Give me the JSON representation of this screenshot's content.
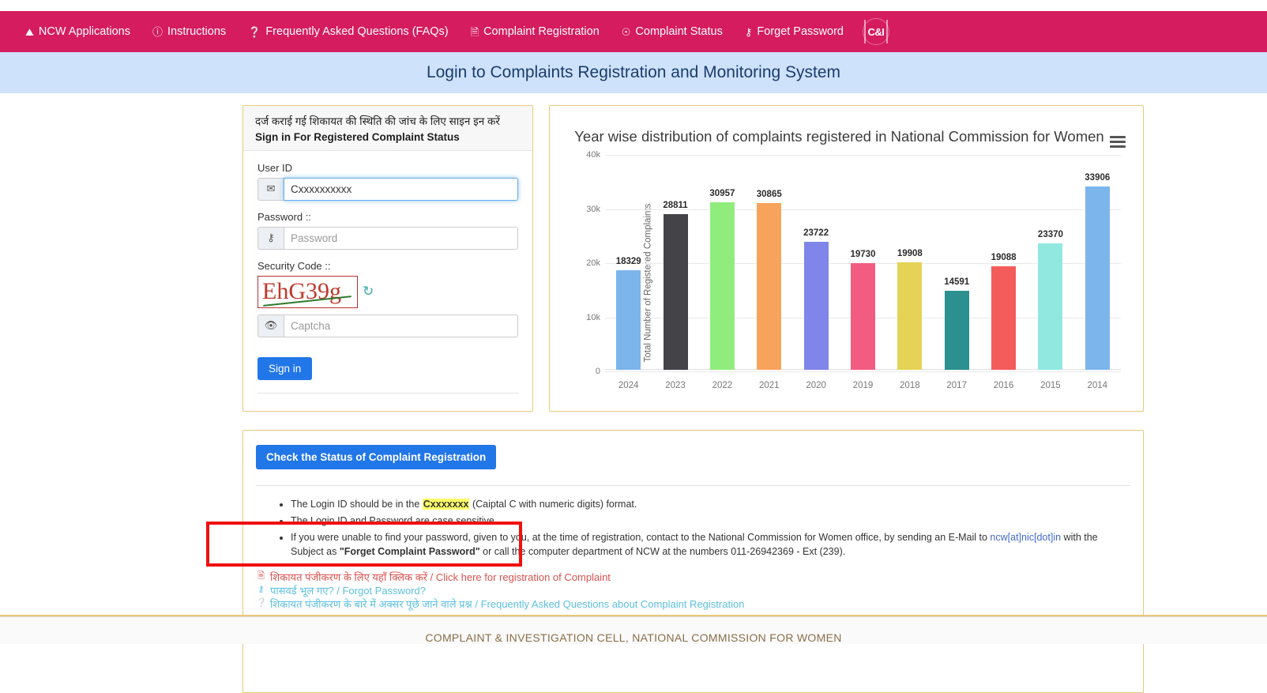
{
  "navbar": {
    "background": "#d51c5e",
    "items": [
      {
        "icon": "home-icon",
        "glyph": "⌂",
        "label": "NCW Applications"
      },
      {
        "icon": "info-icon",
        "glyph": "ℹ",
        "label": "Instructions"
      },
      {
        "icon": "question-circle-icon",
        "glyph": "?",
        "label": "Frequently Asked Questions (FAQs)"
      },
      {
        "icon": "file-icon",
        "glyph": "☰",
        "label": "Complaint Registration"
      },
      {
        "icon": "status-icon",
        "glyph": "☺",
        "label": "Complaint Status"
      },
      {
        "icon": "key-icon",
        "glyph": "⚷",
        "label": "Forget Password"
      }
    ],
    "logo_text": "C&I"
  },
  "title_band": {
    "background": "#cfe2fb",
    "title": "Login to Complaints Registration and Monitoring System"
  },
  "login": {
    "heading_hi": "दर्ज कराई गई शिकायत की स्थिति की जांच के लिए साइन इन करें",
    "heading_en": "Sign in For Registered Complaint Status",
    "userid_label": "User ID",
    "userid_value": "Cxxxxxxxxxx",
    "userid_icon": "envelope-icon",
    "password_label": "Password ::",
    "password_placeholder": "Password",
    "password_icon": "key-icon",
    "security_label": "Security Code ::",
    "captcha_text": "EhG39g",
    "captcha_placeholder": "Captcha",
    "captcha_icon": "eye-icon",
    "refresh_icon": "refresh-icon",
    "signin_label": "Sign in"
  },
  "chart_data": {
    "type": "bar",
    "title": "Year wise distribution of complaints registered in National Commission for Women",
    "xlabel": "",
    "ylabel": "Total Number of Registered Complaints",
    "ylim": [
      0,
      40000
    ],
    "yticks": [
      "0",
      "10k",
      "20k",
      "30k",
      "40k"
    ],
    "ytick_values": [
      0,
      10000,
      20000,
      30000,
      40000
    ],
    "grid": true,
    "legend": "none",
    "categories": [
      "2024",
      "2023",
      "2022",
      "2021",
      "2020",
      "2019",
      "2018",
      "2017",
      "2016",
      "2015",
      "2014"
    ],
    "values": [
      18329,
      28811,
      30957,
      30865,
      23722,
      19730,
      19908,
      14591,
      19088,
      23370,
      33906
    ],
    "colors": [
      "#7cb5ec",
      "#434348",
      "#90ed7d",
      "#f7a35c",
      "#8085e9",
      "#f15c80",
      "#e4d354",
      "#2b908f",
      "#f45b5b",
      "#91e8e1",
      "#7cb5ec"
    ],
    "menu_icon": "hamburger-menu-icon"
  },
  "info": {
    "check_status_label": "Check the Status of Complaint Registration",
    "bullets": [
      {
        "pre": "The Login ID should be in the ",
        "highlight": "Cxxxxxxx",
        "post": " (Caiptal C with numeric digits) format."
      },
      {
        "pre": "The Login ID and Password are case sensitive.",
        "highlight": "",
        "post": ""
      },
      {
        "pre": "If you were unable to find your password, given to you, at the time of registration, contact to the National Commission for Women office, by sending an E-Mail to ",
        "link": "ncw[at]nic[dot]in",
        "mid": " with the Subject as ",
        "bold": "\"Forget Complaint Password\"",
        "post": " or call the computer department of NCW at the numbers 011-26942369 - Ext (239)."
      }
    ],
    "links": [
      {
        "icon": "file-registration-icon",
        "glyph": "☷",
        "text": "शिकायत पंजीकरण के लिए यहाँ क्लिक करें / Click here for registration of Complaint",
        "color": "red"
      },
      {
        "icon": "key-icon",
        "glyph": "⚷",
        "text": "पासवर्ड भूल गए? / Forgot Password?",
        "color": "blue"
      },
      {
        "icon": "question-circle-icon",
        "glyph": "?",
        "text": "शिकायत पंजीकरण के बारे में अक्सर पूछे जाने वाले प्रश्न / Frequently Asked Questions about Complaint Registration",
        "color": "blue"
      }
    ]
  },
  "footer": {
    "text": "COMPLAINT & INVESTIGATION CELL, NATIONAL COMMISSION FOR WOMEN"
  }
}
